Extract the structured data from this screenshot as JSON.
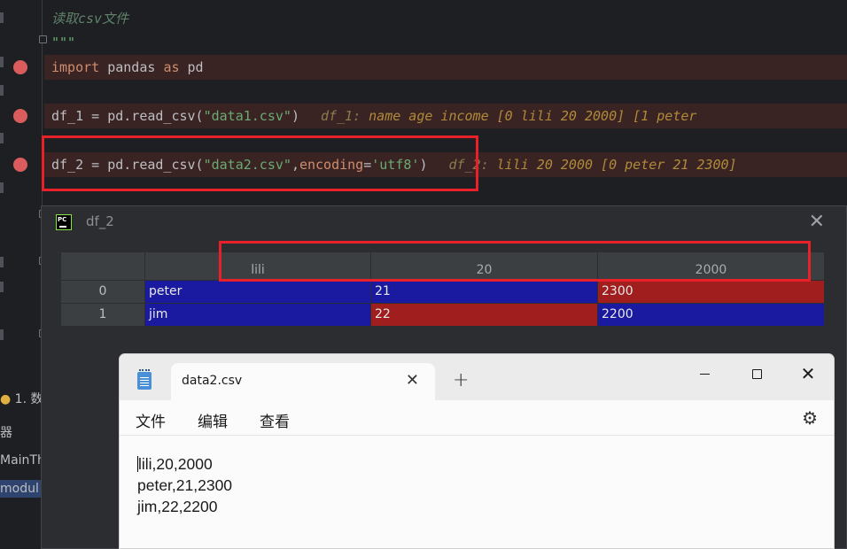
{
  "editor": {
    "comment": "读取csv文件",
    "docstring_end": "\"\"\"",
    "line_import": {
      "kw1": "import",
      "mod": " pandas ",
      "kw2": "as",
      "alias": " pd"
    },
    "line_df1": {
      "code": "df_1 = pd.read_csv(",
      "arg": "\"data1.csv\"",
      "close": ")",
      "hint_name": "df_1:",
      "hint_value": " name  age  income [0   lili   20    2000] [1  peter"
    },
    "line_df2": {
      "code": "df_2 = pd.read_csv(",
      "arg": "\"data2.csv\"",
      "comma": ",",
      "param": "encoding",
      "eq": "=",
      "val": "'utf8'",
      "close": ")",
      "hint_name": "df_2:",
      "hint_value": " lili  20  2000 [0  peter  21  2300]"
    }
  },
  "left_panel": {
    "run_tab": "1. 数",
    "item_a": "器",
    "item_b": "MainTh",
    "item_c": "modul"
  },
  "viewer": {
    "title": "df_2",
    "logo": "PC",
    "columns": [
      "",
      "lili",
      "20",
      "2000"
    ],
    "rows": [
      {
        "index": "0",
        "cells": [
          "peter",
          "21",
          "2300"
        ]
      },
      {
        "index": "1",
        "cells": [
          "jim",
          "22",
          "2200"
        ]
      }
    ]
  },
  "notepad": {
    "tab_title": "data2.csv",
    "new_tab": "+",
    "menus": [
      "文件",
      "编辑",
      "查看"
    ],
    "lines": [
      "lili,20,2000",
      "peter,21,2300",
      "jim,22,2200"
    ]
  },
  "colors": {
    "highlight_box": "#e8202a",
    "cell_blue": "#1a1aa0",
    "cell_red": "#a01e1e",
    "breakpoint": "#db5c5c"
  }
}
